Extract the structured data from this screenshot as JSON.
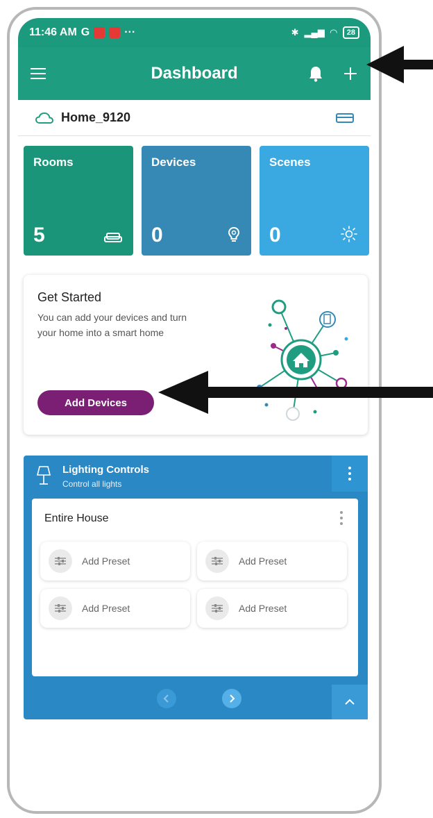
{
  "status_bar": {
    "time": "11:46 AM",
    "carrier_letter": "G",
    "more": "···",
    "battery": "28"
  },
  "app_bar": {
    "title": "Dashboard"
  },
  "home": {
    "name": "Home_9120"
  },
  "tiles": [
    {
      "label": "Rooms",
      "count": "5"
    },
    {
      "label": "Devices",
      "count": "0"
    },
    {
      "label": "Scenes",
      "count": "0"
    }
  ],
  "get_started": {
    "title": "Get Started",
    "description": "You can add your devices and turn your home into a smart home",
    "button": "Add Devices"
  },
  "lighting": {
    "title": "Lighting Controls",
    "subtitle": "Control all lights",
    "group_title": "Entire House",
    "presets": [
      "Add Preset",
      "Add Preset",
      "Add Preset",
      "Add Preset"
    ]
  },
  "colors": {
    "primary": "#1f9d80",
    "rooms": "#1b957a",
    "devices": "#3589b4",
    "scenes": "#3aa9e2",
    "accent_button": "#7a1f74",
    "lighting_panel": "#2a88c4"
  }
}
